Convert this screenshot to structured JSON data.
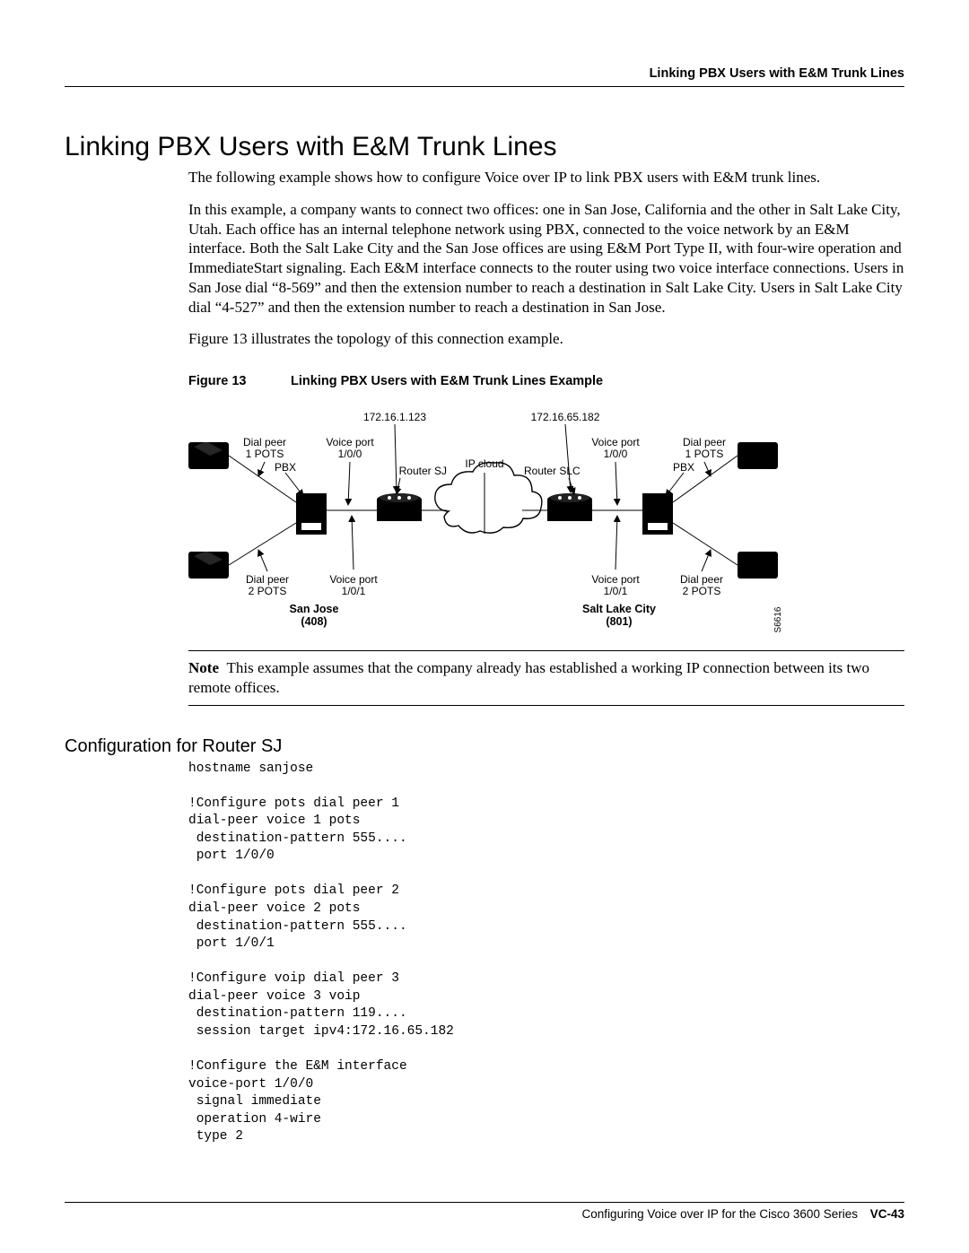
{
  "header": {
    "running_title": "Linking PBX Users with E&M Trunk Lines"
  },
  "section": {
    "title": "Linking PBX Users with E&M Trunk Lines",
    "para1": "The following example shows how to configure Voice over IP to link PBX users with E&M trunk lines.",
    "para2": "In this example, a company wants to connect two offices: one in San Jose, California and the other in Salt Lake City, Utah. Each office has an internal telephone network using PBX, connected to the voice network by an E&M interface. Both the Salt Lake City and the San Jose offices are using E&M Port Type II, with four-wire operation and ImmediateStart signaling. Each E&M interface connects to the router using two voice interface connections. Users in San Jose dial “8-569” and then the extension number to reach a destination in Salt Lake City. Users in Salt Lake City dial “4-527” and then the extension number to reach a destination in San Jose.",
    "para3": "Figure 13 illustrates the topology of this connection example."
  },
  "figure": {
    "label": "Figure 13",
    "caption": "Linking PBX Users with E&M Trunk Lines Example",
    "ip_left": "172.16.1.123",
    "ip_right": "172.16.65.182",
    "dialpeer1": "Dial peer",
    "pots1": "1 POTS",
    "dialpeer2": "Dial peer",
    "pots2": "2 POTS",
    "vport_label": "Voice port",
    "vport_100": "1/0/0",
    "vport_101": "1/0/1",
    "ipcloud": "IP cloud",
    "router_sj": "Router SJ",
    "router_slc": "Router SLC",
    "pbx": "PBX",
    "city_sj": "San Jose",
    "code_sj": "(408)",
    "city_slc": "Salt Lake City",
    "code_slc": "(801)",
    "drawing_id": "S6616"
  },
  "note": {
    "label": "Note",
    "text": "This example assumes that the company already has established a working IP connection between its two remote offices."
  },
  "subsection": {
    "title": "Configuration for Router SJ"
  },
  "config_code": "hostname sanjose\n\n!Configure pots dial peer 1\ndial-peer voice 1 pots\n destination-pattern 555....\n port 1/0/0\n\n!Configure pots dial peer 2\ndial-peer voice 2 pots\n destination-pattern 555....\n port 1/0/1\n\n!Configure voip dial peer 3\ndial-peer voice 3 voip\n destination-pattern 119....\n session target ipv4:172.16.65.182\n\n!Configure the E&M interface\nvoice-port 1/0/0\n signal immediate\n operation 4-wire\n type 2",
  "footer": {
    "doc_title": "Configuring Voice over IP for the Cisco 3600 Series",
    "page": "VC-43"
  }
}
